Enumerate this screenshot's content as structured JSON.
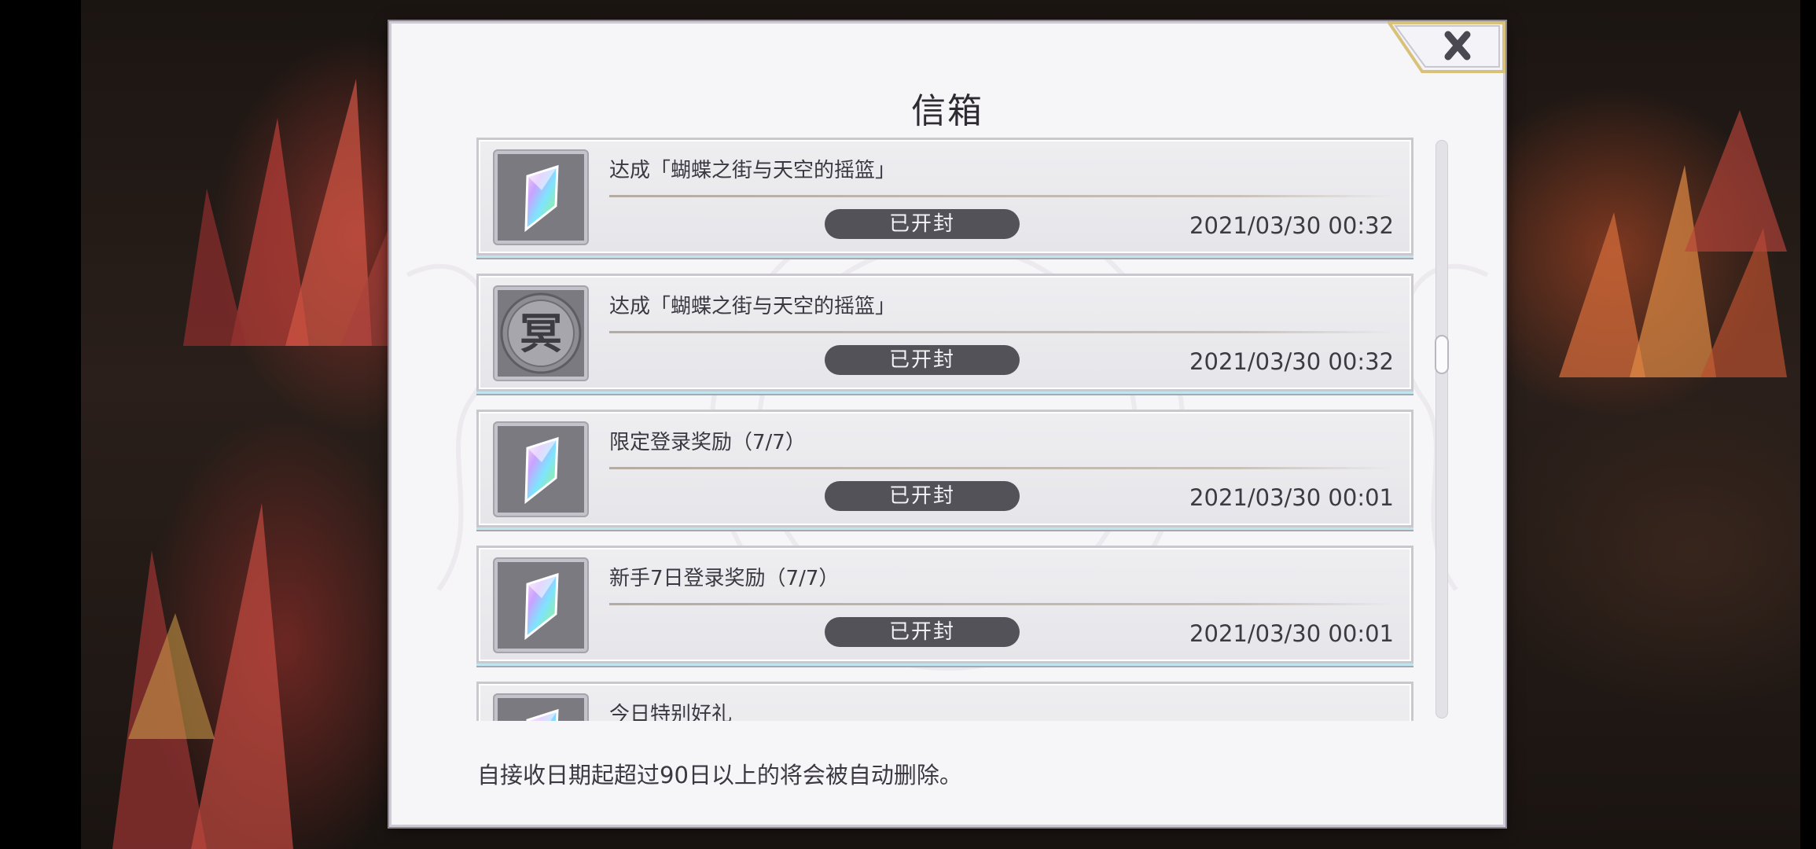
{
  "dialog": {
    "title": "信箱",
    "close_icon": "close-x-icon",
    "footer_note": "自接收日期起超过90日以上的将会被自动删除。"
  },
  "mail_items": [
    {
      "icon": "rainbow-crystal-icon",
      "title": "达成「蝴蝶之街与天空的摇篮」",
      "status": "已开封",
      "date": "2021/03/30 00:32"
    },
    {
      "icon": "mei-coin-icon",
      "icon_text": "冥",
      "title": "达成「蝴蝶之街与天空的摇篮」",
      "status": "已开封",
      "date": "2021/03/30 00:32"
    },
    {
      "icon": "rainbow-crystal-icon",
      "title": "限定登录奖励（7/7）",
      "status": "已开封",
      "date": "2021/03/30 00:01"
    },
    {
      "icon": "rainbow-crystal-icon",
      "title": "新手7日登录奖励（7/7）",
      "status": "已开封",
      "date": "2021/03/30 00:01"
    },
    {
      "icon": "rainbow-crystal-icon",
      "title": "今日特别好礼"
    }
  ],
  "colors": {
    "dialog_bg": "#f6f5f8",
    "badge_bg": "#535258",
    "close_frame": "#d8c27a"
  }
}
